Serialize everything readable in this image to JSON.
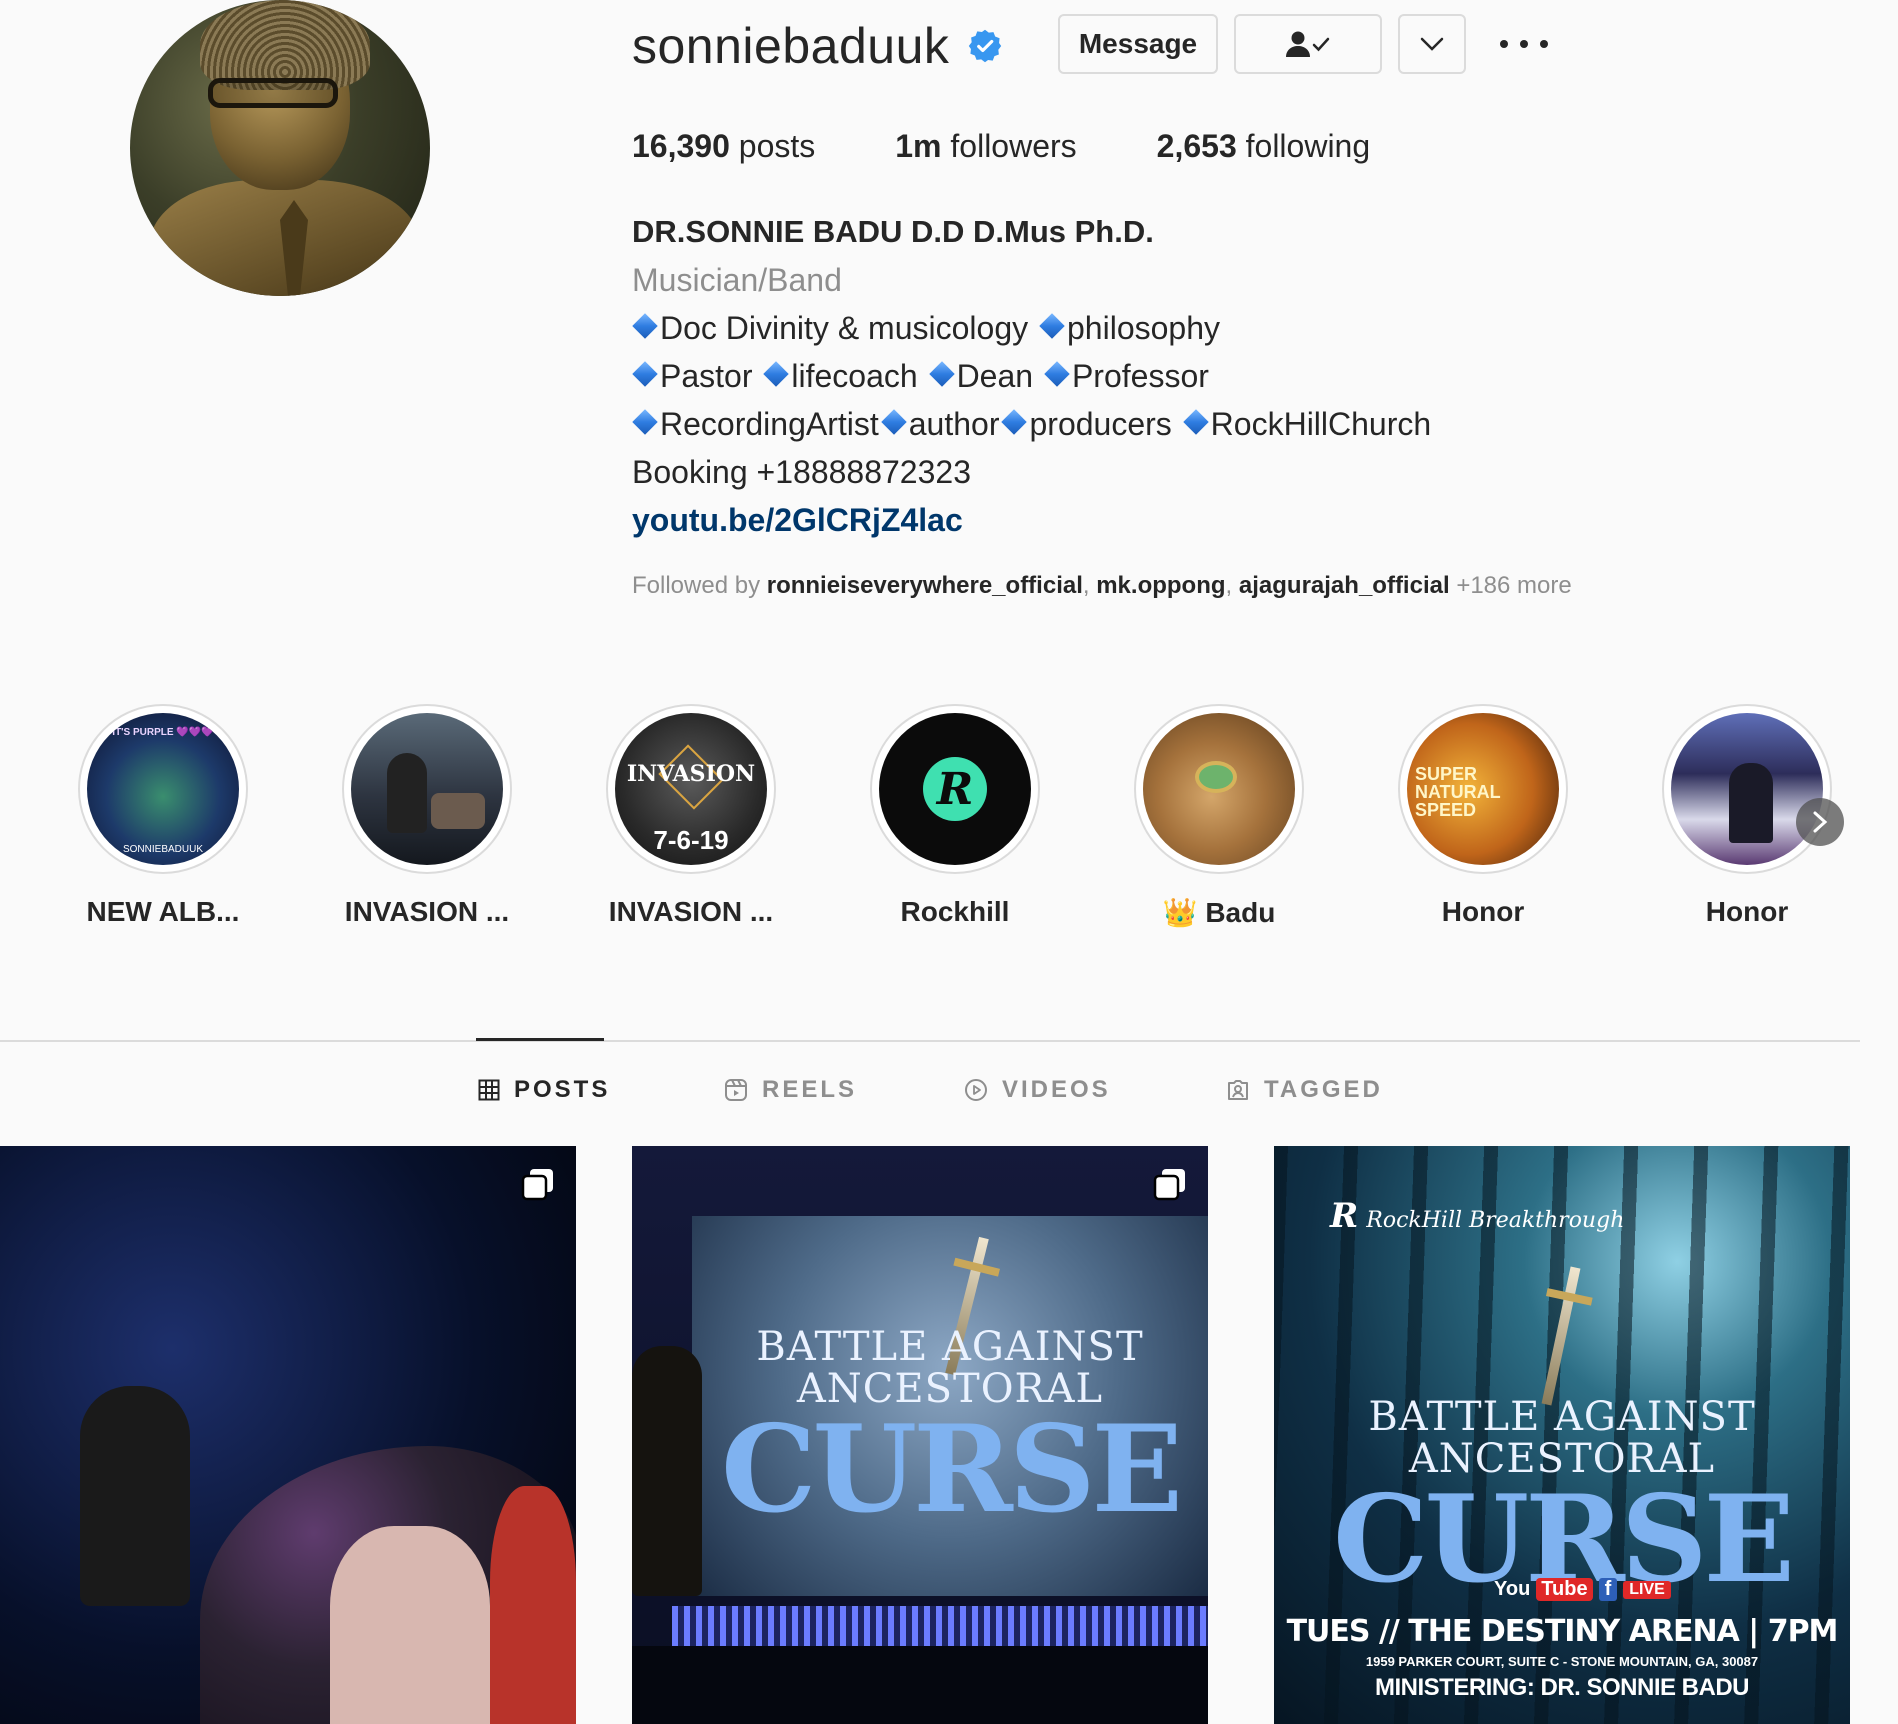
{
  "profile": {
    "username": "sonniebaduuk",
    "verified": true,
    "buttons": {
      "message": "Message"
    },
    "stats": {
      "posts_count": "16,390",
      "posts_label": "posts",
      "followers_count": "1m",
      "followers_label": "followers",
      "following_count": "2,653",
      "following_label": "following"
    },
    "full_name": "DR.SONNIE BADU D.D D.Mus Ph.D.",
    "category": "Musician/Band",
    "bio_lines": [
      [
        "Doc Divinity & musicology ",
        "philosophy"
      ],
      [
        "Pastor ",
        "lifecoach ",
        "Dean ",
        "Professor"
      ],
      [
        "RecordingArtist",
        "author",
        "producers ",
        "RockHillChurch"
      ]
    ],
    "booking": "Booking +18888872323",
    "link": "youtu.be/2GlCRjZ4lac",
    "followed_by": {
      "prefix": "Followed by ",
      "accounts": [
        "ronnieiseverywhere_official",
        "mk.oppong",
        "ajagurajah_official"
      ],
      "more": "+186 more"
    }
  },
  "highlights": [
    {
      "title": "NEW ALB...",
      "thumb_text": "IT'S PURPLE 💜💜💜",
      "thumb_text2": "SONNIEBADUUK"
    },
    {
      "title": "INVASION ..."
    },
    {
      "title": "INVASION ...",
      "thumb_text": "INVASION",
      "thumb_text2": "7-6-19"
    },
    {
      "title": "Rockhill",
      "thumb_text": "R"
    },
    {
      "title": "👑 Badu"
    },
    {
      "title": "Honor",
      "thumb_text": "SUPER NATURAL SPEED"
    },
    {
      "title": "Honor"
    }
  ],
  "tabs": [
    {
      "label": "POSTS",
      "icon": "grid-icon",
      "active": true
    },
    {
      "label": "REELS",
      "icon": "reels-icon",
      "active": false
    },
    {
      "label": "VIDEOS",
      "icon": "play-icon",
      "active": false
    },
    {
      "label": "TAGGED",
      "icon": "tagged-icon",
      "active": false
    }
  ],
  "posts": [
    {
      "type": "carousel"
    },
    {
      "type": "carousel",
      "line1": "BATTLE AGAINST",
      "line2": "ANCESTORAL",
      "big": "CURSE"
    },
    {
      "line1": "BATTLE AGAINST",
      "line2": "ANCESTORAL",
      "big": "CURSE",
      "logo_letter": "R",
      "logo_text": "RockHill Breakthrough",
      "yt_you": "You",
      "yt_tube": "Tube",
      "fb": "f",
      "live": "LIVE",
      "tues": "TUES // THE DESTINY ARENA | 7PM",
      "address": "1959 PARKER COURT, SUITE C - STONE MOUNTAIN, GA, 30087",
      "ministering": "MINISTERING: DR. SONNIE BADU"
    }
  ],
  "colors": {
    "verified": "#3897f0",
    "link": "#00376b",
    "muted": "#8e8e8e",
    "text": "#262626"
  }
}
